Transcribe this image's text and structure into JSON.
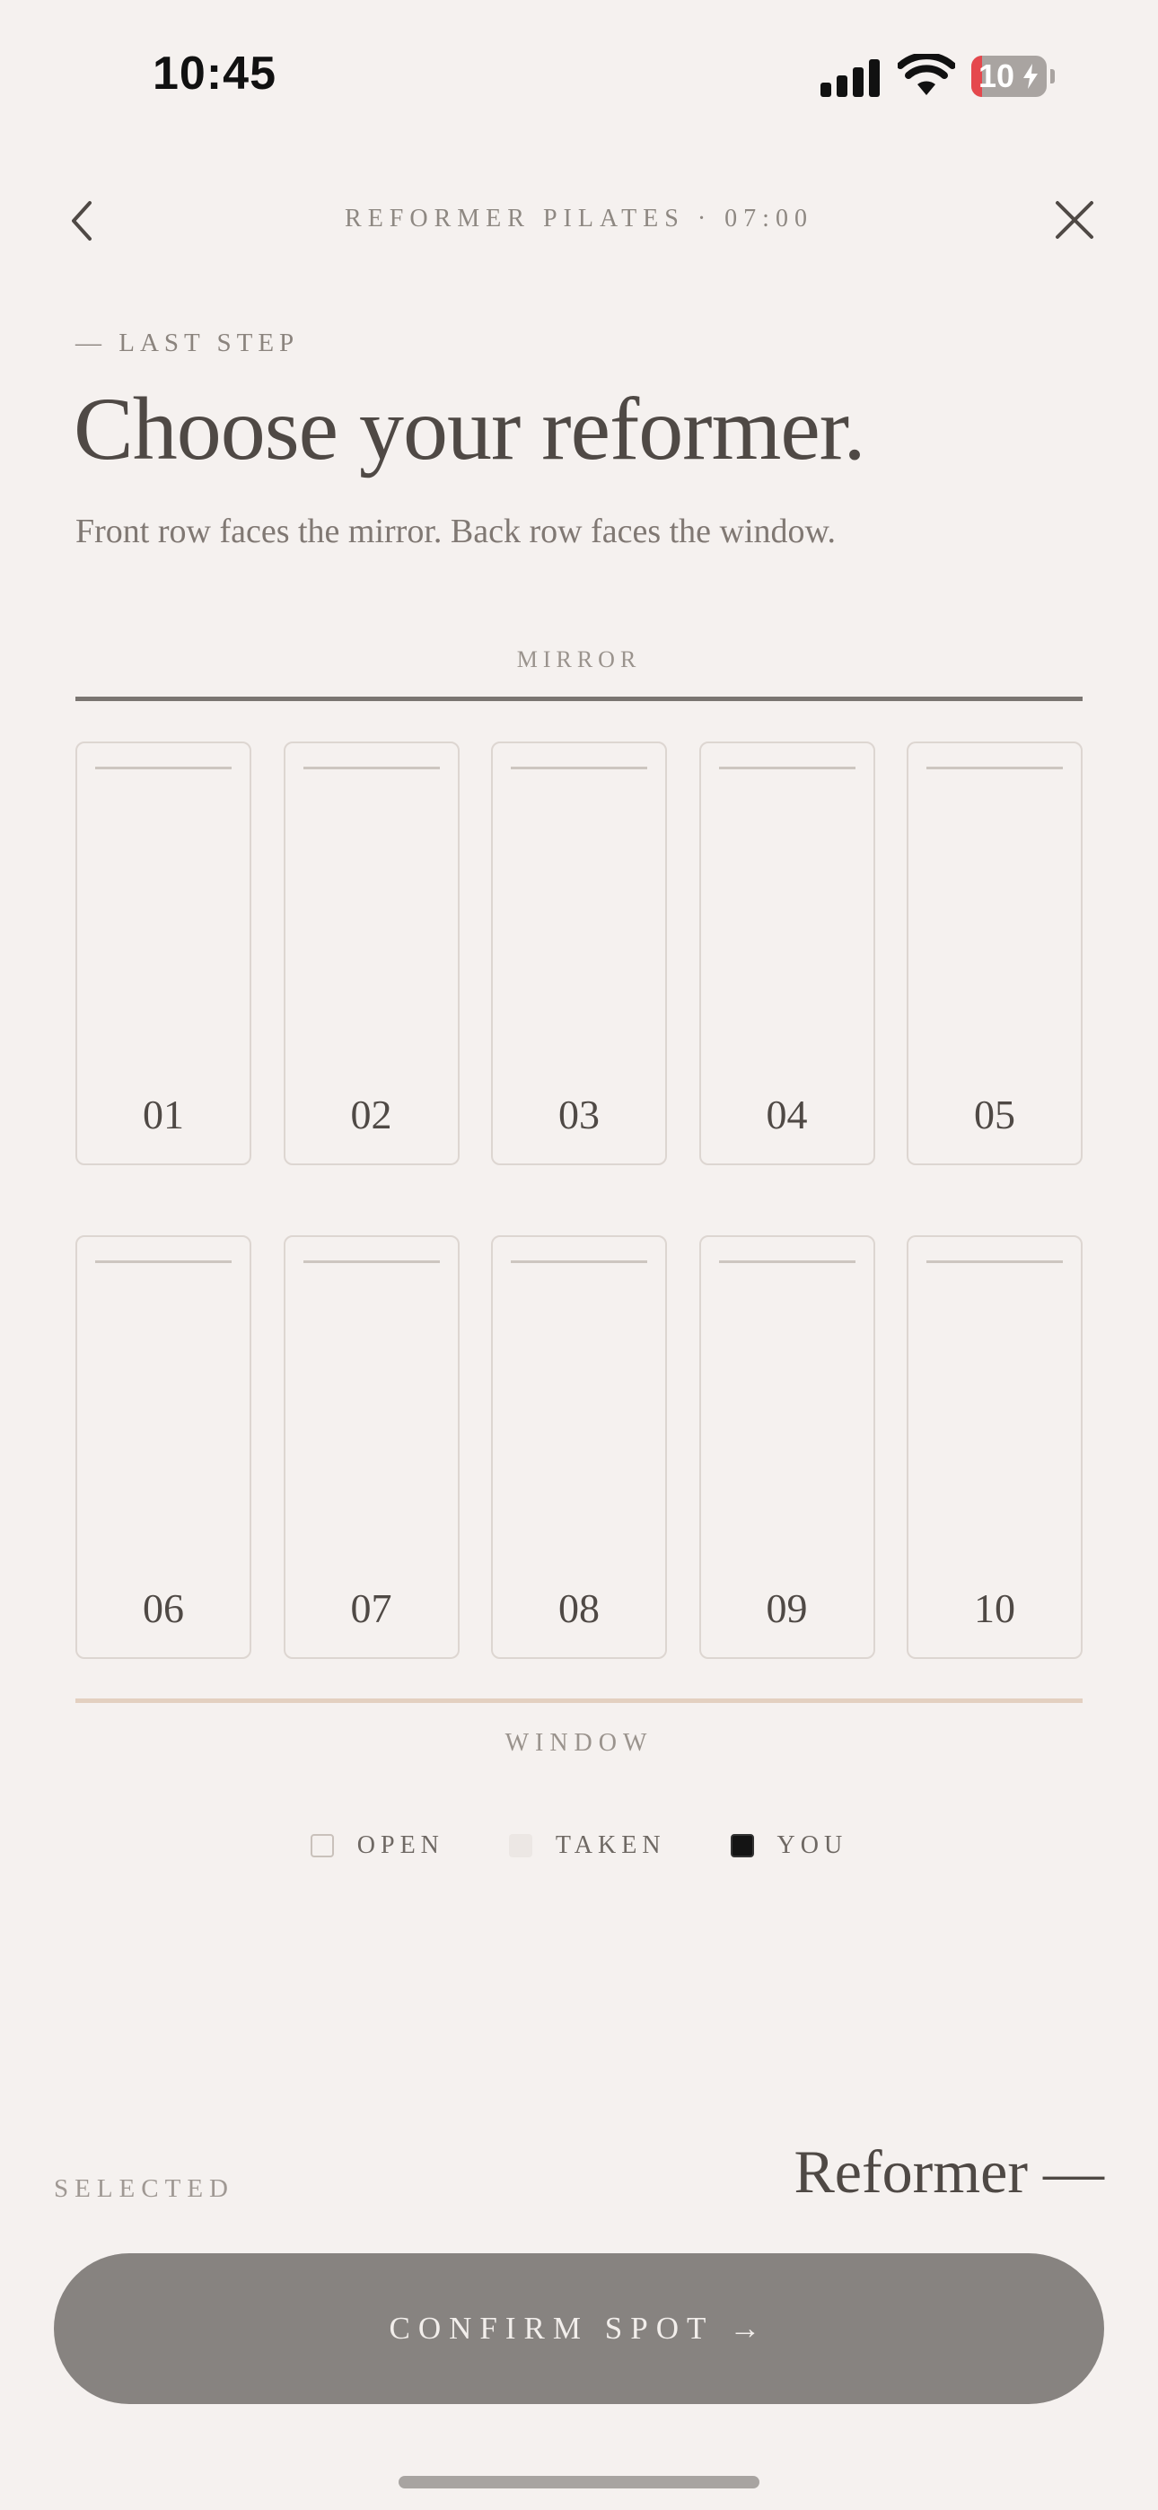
{
  "status_bar": {
    "time": "10:45",
    "battery_level": "10",
    "signal_icon": "cellular-signal-icon",
    "wifi_icon": "wifi-icon",
    "battery_icon": "battery-charging-icon"
  },
  "header": {
    "title": "REFORMER PILATES · 07:00",
    "back_icon": "chevron-left-icon",
    "close_icon": "close-icon"
  },
  "intro": {
    "eyebrow": "— LAST STEP",
    "title": "Choose your reformer.",
    "subtitle": "Front row faces the mirror. Back row faces the window."
  },
  "layout": {
    "mirror_label": "MIRROR",
    "window_label": "WINDOW",
    "front_row": [
      {
        "number": "01",
        "status": "open"
      },
      {
        "number": "02",
        "status": "open"
      },
      {
        "number": "03",
        "status": "open"
      },
      {
        "number": "04",
        "status": "open"
      },
      {
        "number": "05",
        "status": "open"
      }
    ],
    "back_row": [
      {
        "number": "06",
        "status": "open"
      },
      {
        "number": "07",
        "status": "open"
      },
      {
        "number": "08",
        "status": "open"
      },
      {
        "number": "09",
        "status": "open"
      },
      {
        "number": "10",
        "status": "open"
      }
    ]
  },
  "legend": {
    "open": "OPEN",
    "taken": "TAKEN",
    "you": "YOU"
  },
  "footer": {
    "selected_label": "SELECTED",
    "selected_value": "Reformer —",
    "confirm_label": "CONFIRM SPOT →"
  },
  "colors": {
    "background": "#f5f1ef",
    "button": "#878380",
    "mirror_line": "#7a7571",
    "window_line": "#e3d0c0",
    "you": "#141414"
  }
}
